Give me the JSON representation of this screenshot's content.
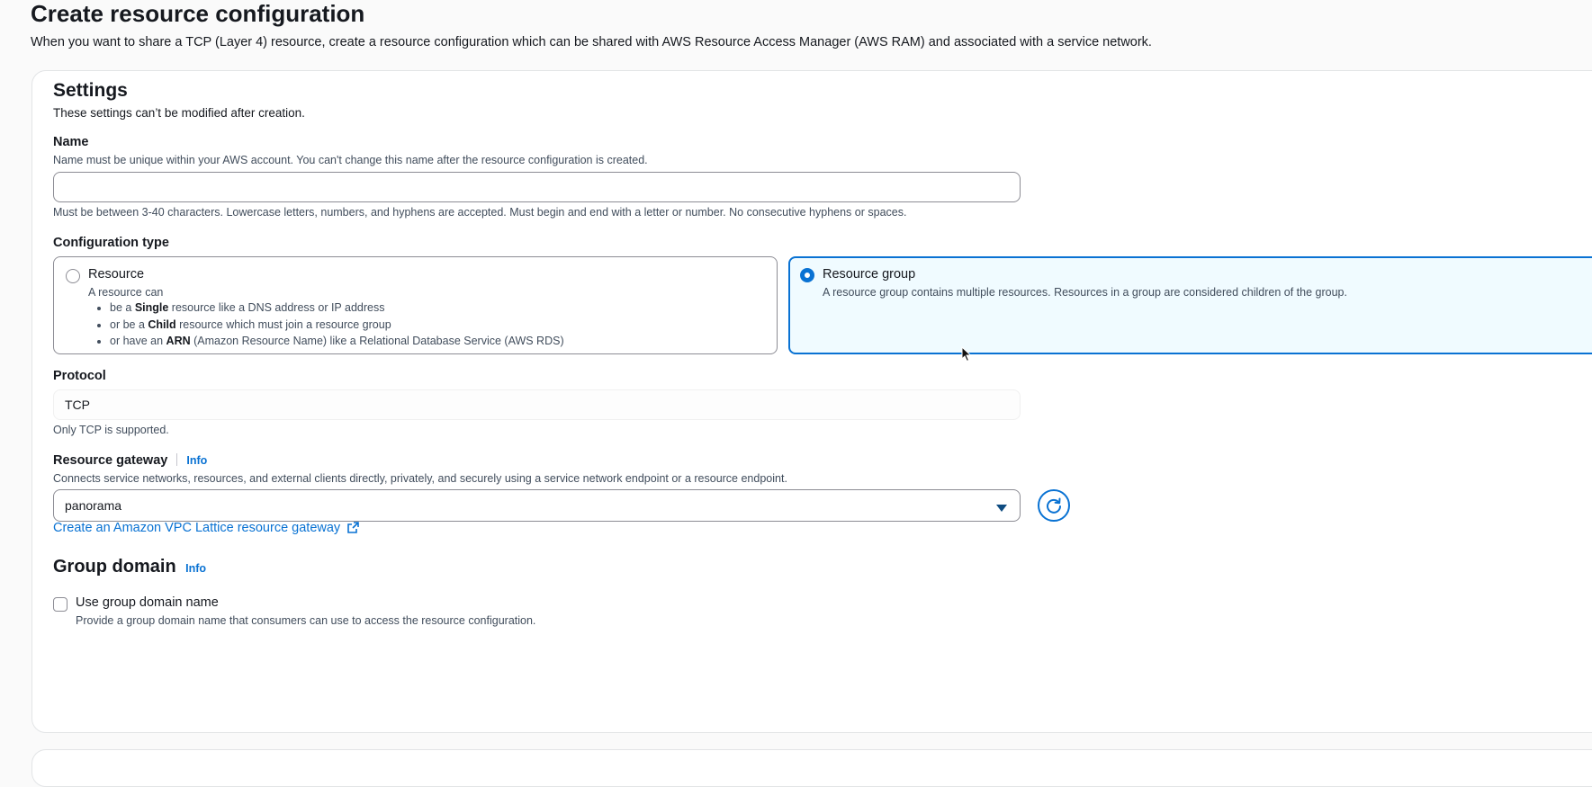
{
  "header": {
    "title": "Create resource configuration",
    "description": "When you want to share a TCP (Layer 4) resource, create a resource configuration which can be shared with AWS Resource Access Manager (AWS RAM) and associated with a service network."
  },
  "settings": {
    "title": "Settings",
    "description": "These settings can’t be modified after creation.",
    "name": {
      "label": "Name",
      "description": "Name must be unique within your AWS account. You can't change this name after the resource configuration is created.",
      "value": "",
      "constraint": "Must be between 3-40 characters. Lowercase letters, numbers, and hyphens are accepted. Must begin and end with a letter or number. No consecutive hyphens or spaces."
    },
    "configuration_type": {
      "label": "Configuration type",
      "selected": "Resource group",
      "resource": {
        "title": "Resource",
        "intro": "A resource can",
        "bullets": [
          {
            "pre": "be a ",
            "bold": "Single",
            "post": " resource like a DNS address or IP address"
          },
          {
            "pre": "or be a ",
            "bold": "Child",
            "post": " resource which must join a resource group"
          },
          {
            "pre": "or have an ",
            "bold": "ARN",
            "post": " (Amazon Resource Name) like a Relational Database Service (AWS RDS)"
          }
        ]
      },
      "resource_group": {
        "title": "Resource group",
        "description": "A resource group contains multiple resources. Resources in a group are considered children of the group."
      }
    },
    "protocol": {
      "label": "Protocol",
      "value": "TCP",
      "hint": "Only TCP is supported."
    },
    "resource_gateway": {
      "label": "Resource gateway",
      "info": "Info",
      "description": "Connects service networks, resources, and external clients directly, privately, and securely using a service network endpoint or a resource endpoint.",
      "selected": "panorama",
      "create_link": "Create an Amazon VPC Lattice resource gateway"
    },
    "group_domain": {
      "title": "Group domain",
      "info": "Info",
      "checkbox_label": "Use group domain name",
      "checkbox_checked": false,
      "checkbox_description": "Provide a group domain name that consumers can use to access the resource configuration."
    }
  },
  "colors": {
    "accent": "#0972d3",
    "text": "#16191f",
    "secondary_text": "#414d5c",
    "border": "#8c8c94"
  }
}
